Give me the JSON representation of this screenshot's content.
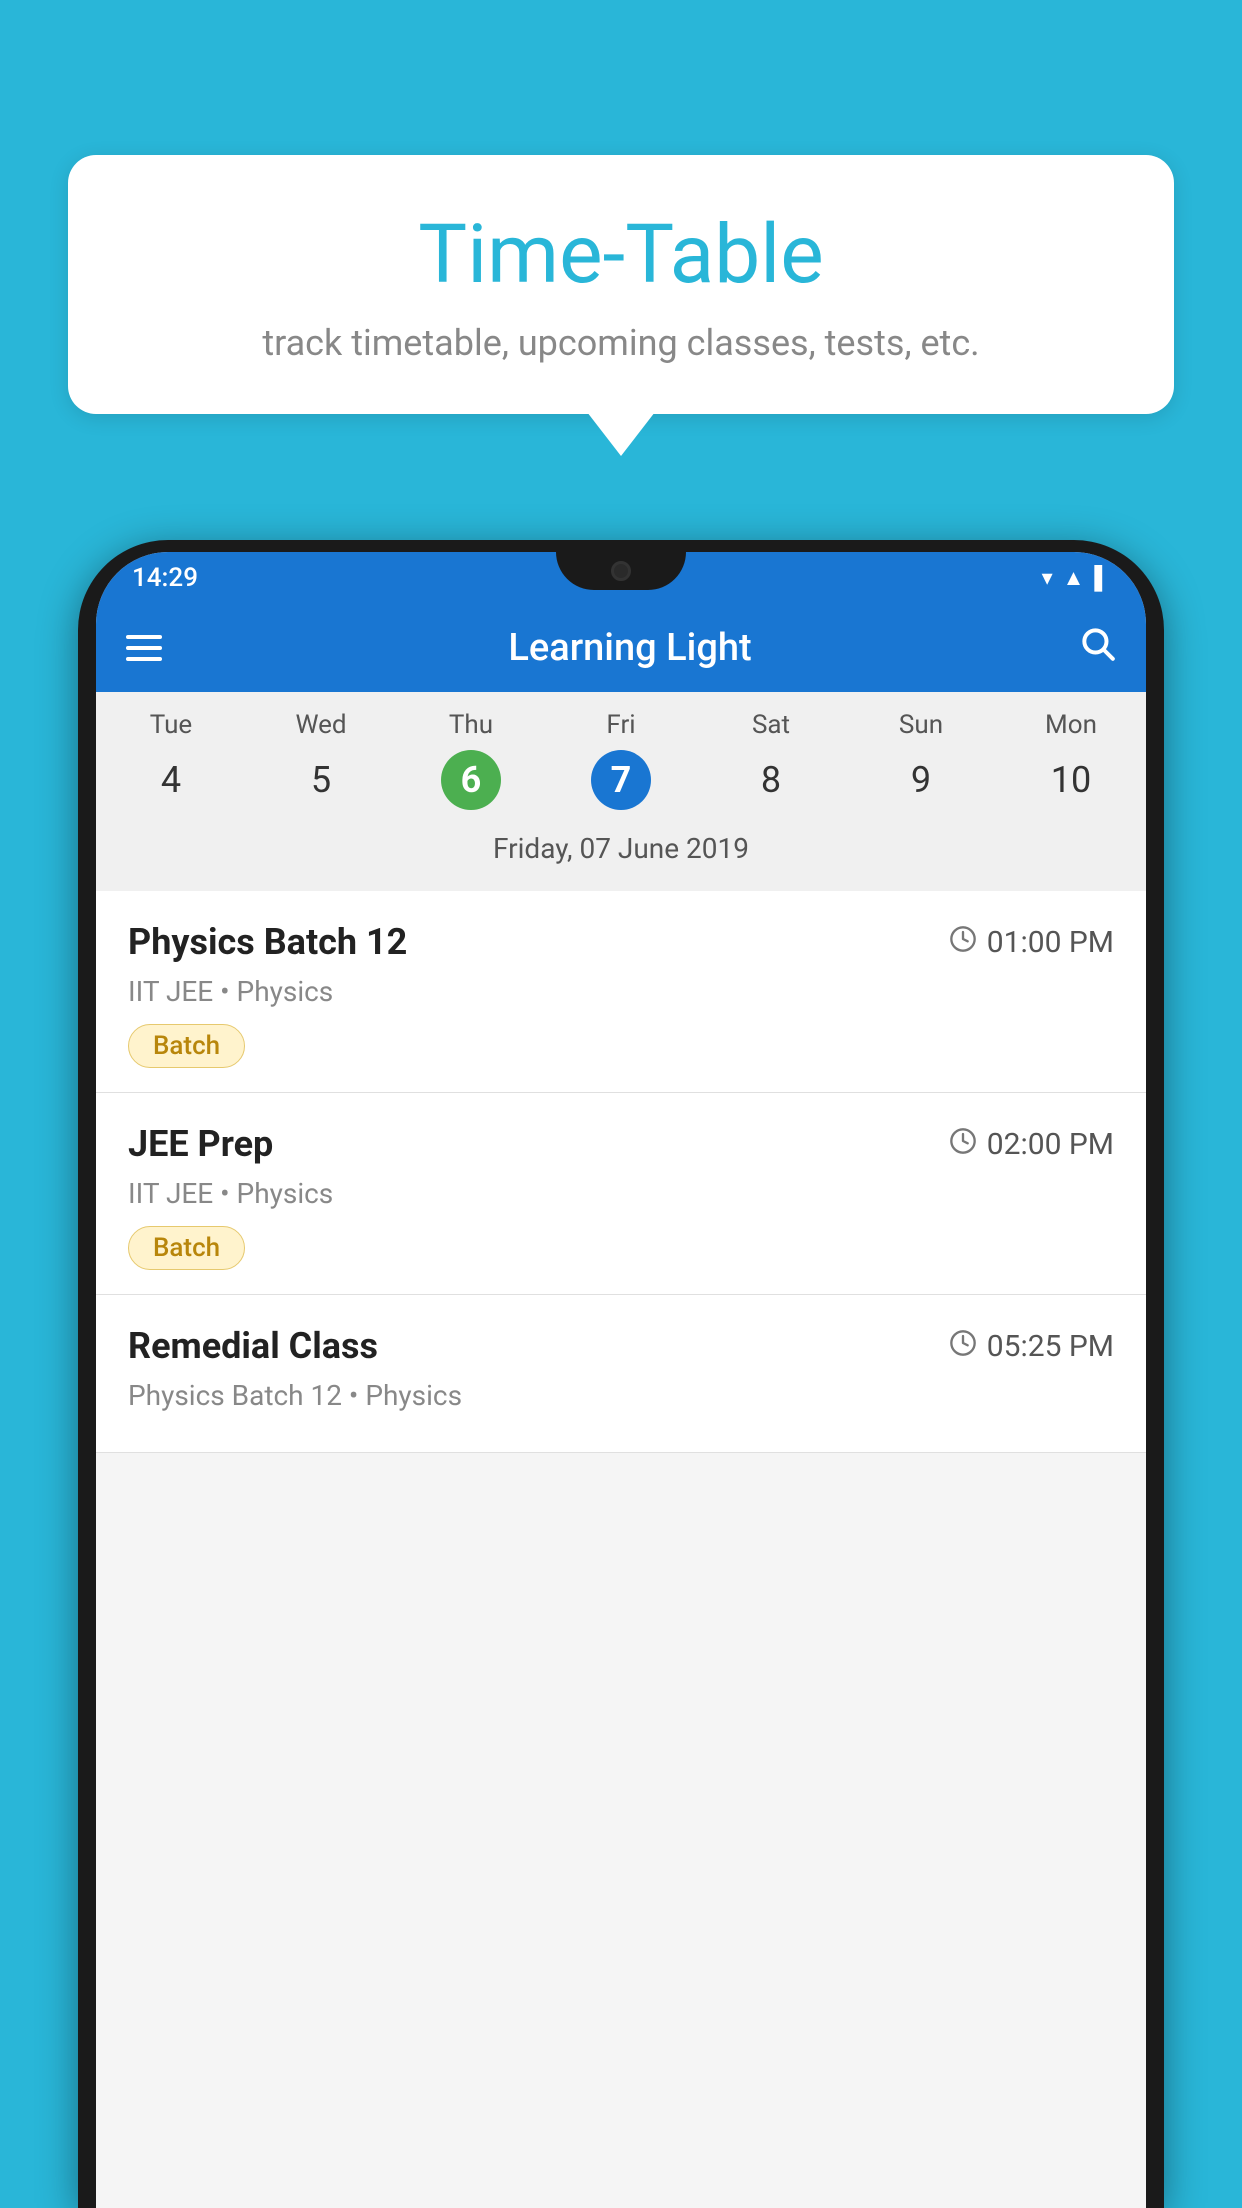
{
  "background_color": "#29b6d8",
  "bubble": {
    "title": "Time-Table",
    "subtitle": "track timetable, upcoming classes, tests, etc."
  },
  "status_bar": {
    "time": "14:29"
  },
  "app_bar": {
    "title": "Learning Light",
    "menu_icon": "≡",
    "search_icon": "🔍"
  },
  "calendar": {
    "days": [
      "Tue",
      "Wed",
      "Thu",
      "Fri",
      "Sat",
      "Sun",
      "Mon"
    ],
    "dates": [
      "4",
      "5",
      "6",
      "7",
      "8",
      "9",
      "10"
    ],
    "today_index": 2,
    "selected_index": 3,
    "selected_date_label": "Friday, 07 June 2019"
  },
  "schedule": [
    {
      "title": "Physics Batch 12",
      "time": "01:00 PM",
      "subtitle": "IIT JEE • Physics",
      "badge": "Batch"
    },
    {
      "title": "JEE Prep",
      "time": "02:00 PM",
      "subtitle": "IIT JEE • Physics",
      "badge": "Batch"
    },
    {
      "title": "Remedial Class",
      "time": "05:25 PM",
      "subtitle": "Physics Batch 12 • Physics",
      "badge": ""
    }
  ]
}
